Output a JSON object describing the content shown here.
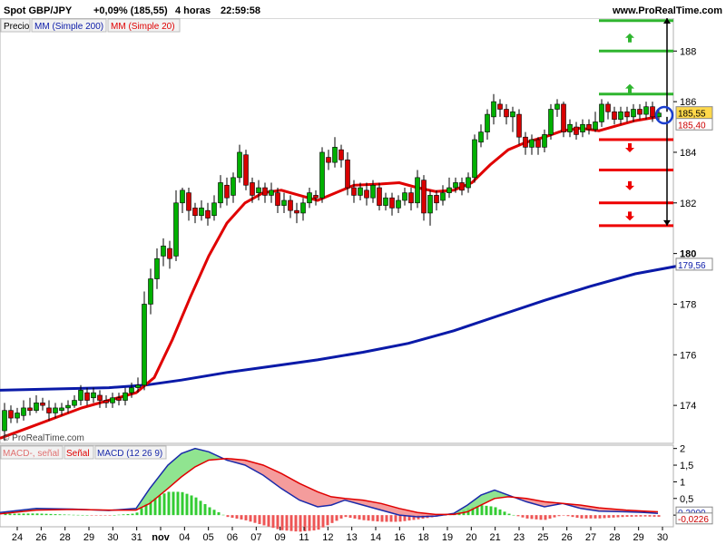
{
  "header": {
    "instrument": "Spot GBP/JPY",
    "change": "+0,09% (185,55)",
    "timeframe": "4 horas",
    "time": "22:59:58",
    "site": "www.ProRealTime.com"
  },
  "legend": {
    "price": "Precio",
    "mm200": "MM (Simple 200)",
    "mm20": "MM (Simple 20)"
  },
  "watermark": "© ProRealTime.com",
  "macd_legend": {
    "item1": "MACD-, señal",
    "item2": "Señal",
    "item3": "MACD (12 26 9)"
  },
  "colors": {
    "up_candle": "#00b000",
    "down_candle": "#d80000",
    "mm200": "#0a1aa8",
    "mm20": "#e00000",
    "resistance": "#2fb52f",
    "support": "#ee0000",
    "macd_hist": "#33cc33"
  },
  "chart_data": {
    "type": "candlestick",
    "x_labels": [
      "24",
      "26",
      "28",
      "29",
      "30",
      "31",
      "nov",
      "04",
      "05",
      "06",
      "07",
      "09",
      "11",
      "12",
      "13",
      "14",
      "16",
      "18",
      "19",
      "20",
      "21",
      "23",
      "25",
      "26",
      "27",
      "28",
      "29",
      "30"
    ],
    "y_ticks": [
      174,
      176,
      178,
      180,
      182,
      184,
      186,
      188
    ],
    "ylim": [
      172.5,
      189.3
    ],
    "last_price_label": "185,55",
    "prev_label": "185,40",
    "mm200_label": "179,56",
    "highlight_tick": "180",
    "resistance_levels": [
      189.2,
      188.0,
      186.3
    ],
    "support_levels": [
      184.5,
      183.3,
      182.0,
      181.1
    ],
    "mm200_points": [
      [
        0,
        174.6
      ],
      [
        60,
        174.65
      ],
      [
        120,
        174.7
      ],
      [
        160,
        174.8
      ],
      [
        200,
        175.0
      ],
      [
        250,
        175.3
      ],
      [
        300,
        175.55
      ],
      [
        350,
        175.8
      ],
      [
        400,
        176.1
      ],
      [
        450,
        176.45
      ],
      [
        500,
        176.95
      ],
      [
        550,
        177.55
      ],
      [
        600,
        178.15
      ],
      [
        650,
        178.7
      ],
      [
        700,
        179.2
      ],
      [
        755,
        179.56
      ]
    ],
    "mm20_points": [
      [
        0,
        172.7
      ],
      [
        30,
        173.1
      ],
      [
        60,
        173.5
      ],
      [
        90,
        173.9
      ],
      [
        120,
        174.2
      ],
      [
        150,
        174.5
      ],
      [
        170,
        175.1
      ],
      [
        190,
        176.6
      ],
      [
        210,
        178.3
      ],
      [
        230,
        179.9
      ],
      [
        250,
        181.2
      ],
      [
        270,
        182.0
      ],
      [
        290,
        182.4
      ],
      [
        310,
        182.5
      ],
      [
        330,
        182.3
      ],
      [
        350,
        182.1
      ],
      [
        370,
        182.4
      ],
      [
        390,
        182.7
      ],
      [
        420,
        182.75
      ],
      [
        440,
        182.8
      ],
      [
        460,
        182.6
      ],
      [
        480,
        182.45
      ],
      [
        500,
        182.5
      ],
      [
        520,
        182.8
      ],
      [
        540,
        183.5
      ],
      [
        560,
        184.1
      ],
      [
        580,
        184.4
      ],
      [
        600,
        184.6
      ],
      [
        620,
        184.85
      ],
      [
        640,
        184.95
      ],
      [
        660,
        184.85
      ],
      [
        680,
        185.05
      ],
      [
        700,
        185.25
      ],
      [
        725,
        185.4
      ]
    ],
    "candles": [
      [
        5,
        173.0,
        173.8,
        172.6,
        174.1
      ],
      [
        12,
        173.8,
        173.5,
        173.3,
        174.0
      ],
      [
        19,
        173.5,
        173.7,
        173.3,
        173.9
      ],
      [
        26,
        173.6,
        173.9,
        173.4,
        174.2
      ],
      [
        33,
        173.9,
        173.8,
        173.6,
        174.3
      ],
      [
        40,
        173.8,
        174.1,
        173.7,
        174.4
      ],
      [
        47,
        174.1,
        174.0,
        173.8,
        174.3
      ],
      [
        54,
        173.9,
        173.7,
        173.4,
        174.2
      ],
      [
        61,
        173.7,
        173.9,
        173.5,
        174.1
      ],
      [
        68,
        173.8,
        173.9,
        173.6,
        174.1
      ],
      [
        75,
        173.9,
        174.0,
        173.7,
        174.2
      ],
      [
        82,
        174.0,
        174.2,
        173.9,
        174.4
      ],
      [
        89,
        174.2,
        174.6,
        174.0,
        174.8
      ],
      [
        96,
        174.5,
        174.2,
        174.0,
        174.7
      ],
      [
        103,
        174.3,
        174.5,
        174.1,
        174.7
      ],
      [
        110,
        174.4,
        174.2,
        173.9,
        174.6
      ],
      [
        117,
        174.2,
        174.1,
        173.9,
        174.4
      ],
      [
        124,
        174.1,
        174.3,
        173.9,
        174.5
      ],
      [
        131,
        174.3,
        174.2,
        174.0,
        174.5
      ],
      [
        138,
        174.2,
        174.5,
        174.0,
        174.7
      ],
      [
        145,
        174.5,
        174.7,
        174.3,
        174.9
      ],
      [
        152,
        174.7,
        174.8,
        174.5,
        175.1
      ],
      [
        159,
        174.8,
        178.0,
        174.6,
        178.5
      ],
      [
        166,
        178.0,
        179.0,
        177.6,
        179.4
      ],
      [
        173,
        179.0,
        179.8,
        178.6,
        180.2
      ],
      [
        180,
        179.9,
        180.3,
        179.5,
        180.6
      ],
      [
        187,
        180.2,
        179.8,
        179.4,
        180.5
      ],
      [
        194,
        179.9,
        182.0,
        179.7,
        182.5
      ],
      [
        201,
        182.0,
        182.5,
        181.6,
        182.6
      ],
      [
        208,
        182.4,
        181.7,
        181.3,
        182.6
      ],
      [
        215,
        181.8,
        181.5,
        181.2,
        182.0
      ],
      [
        222,
        181.5,
        181.8,
        181.3,
        182.1
      ],
      [
        229,
        181.7,
        181.4,
        181.1,
        182.0
      ],
      [
        236,
        181.5,
        182.0,
        181.3,
        182.3
      ],
      [
        243,
        182.0,
        182.8,
        181.8,
        183.1
      ],
      [
        250,
        182.7,
        182.2,
        181.9,
        183.0
      ],
      [
        257,
        182.3,
        183.0,
        182.0,
        183.2
      ],
      [
        264,
        183.0,
        184.0,
        182.8,
        184.3
      ],
      [
        271,
        183.9,
        182.7,
        182.5,
        184.1
      ],
      [
        278,
        182.8,
        182.3,
        182.0,
        183.0
      ],
      [
        285,
        182.4,
        182.6,
        182.1,
        182.9
      ],
      [
        292,
        182.6,
        182.3,
        182.0,
        182.8
      ],
      [
        299,
        182.3,
        182.5,
        182.0,
        182.8
      ],
      [
        306,
        182.4,
        181.9,
        181.6,
        182.6
      ],
      [
        313,
        181.9,
        182.1,
        181.6,
        182.4
      ],
      [
        320,
        182.1,
        181.7,
        181.4,
        182.3
      ],
      [
        327,
        181.7,
        181.6,
        181.2,
        182.0
      ],
      [
        334,
        181.6,
        182.0,
        181.3,
        182.2
      ],
      [
        341,
        182.0,
        182.4,
        181.8,
        182.6
      ],
      [
        348,
        182.3,
        182.2,
        181.9,
        182.5
      ],
      [
        355,
        182.2,
        184.0,
        182.0,
        184.2
      ],
      [
        362,
        183.8,
        183.6,
        183.3,
        184.1
      ],
      [
        369,
        183.6,
        184.2,
        183.4,
        184.6
      ],
      [
        376,
        184.1,
        183.7,
        183.4,
        184.3
      ],
      [
        383,
        183.7,
        182.6,
        182.3,
        184.0
      ],
      [
        390,
        182.6,
        182.3,
        182.0,
        182.9
      ],
      [
        397,
        182.3,
        182.6,
        182.1,
        182.8
      ],
      [
        404,
        182.5,
        182.2,
        181.9,
        182.8
      ],
      [
        411,
        182.2,
        182.7,
        182.0,
        182.9
      ],
      [
        418,
        182.6,
        181.9,
        181.7,
        182.8
      ],
      [
        425,
        181.9,
        182.2,
        181.7,
        182.4
      ],
      [
        432,
        182.2,
        181.8,
        181.5,
        182.4
      ],
      [
        439,
        181.8,
        182.1,
        181.6,
        182.3
      ],
      [
        446,
        182.1,
        182.4,
        181.9,
        182.6
      ],
      [
        453,
        182.4,
        182.0,
        181.7,
        182.6
      ],
      [
        460,
        182.0,
        183.0,
        181.8,
        183.3
      ],
      [
        467,
        182.9,
        181.6,
        181.3,
        183.1
      ],
      [
        474,
        181.6,
        182.3,
        181.1,
        182.5
      ],
      [
        481,
        182.3,
        182.0,
        181.7,
        182.5
      ],
      [
        488,
        182.1,
        182.4,
        181.9,
        182.7
      ],
      [
        495,
        182.4,
        182.6,
        182.2,
        183.0
      ],
      [
        502,
        182.6,
        182.8,
        182.4,
        183.0
      ],
      [
        509,
        182.8,
        182.5,
        182.3,
        183.0
      ],
      [
        516,
        182.6,
        183.0,
        182.4,
        183.2
      ],
      [
        523,
        183.0,
        184.5,
        182.8,
        184.7
      ],
      [
        530,
        184.4,
        184.8,
        184.2,
        185.1
      ],
      [
        537,
        184.8,
        185.5,
        184.5,
        185.7
      ],
      [
        544,
        185.4,
        186.0,
        185.1,
        186.3
      ],
      [
        551,
        185.9,
        185.7,
        185.4,
        186.1
      ],
      [
        558,
        185.7,
        185.4,
        185.1,
        185.9
      ],
      [
        565,
        185.4,
        185.6,
        184.8,
        185.8
      ],
      [
        572,
        185.5,
        184.6,
        184.3,
        185.7
      ],
      [
        579,
        184.6,
        184.2,
        183.9,
        184.8
      ],
      [
        586,
        184.2,
        184.5,
        183.9,
        184.7
      ],
      [
        593,
        184.5,
        184.2,
        183.9,
        184.6
      ],
      [
        600,
        184.2,
        184.7,
        184.0,
        184.9
      ],
      [
        607,
        184.7,
        185.7,
        184.5,
        185.9
      ],
      [
        614,
        185.7,
        185.9,
        185.4,
        186.1
      ],
      [
        621,
        185.9,
        184.8,
        184.6,
        186.0
      ],
      [
        628,
        184.8,
        185.1,
        184.6,
        185.3
      ],
      [
        635,
        185.0,
        184.7,
        184.5,
        185.2
      ],
      [
        642,
        184.8,
        185.1,
        184.6,
        185.3
      ],
      [
        649,
        185.1,
        184.9,
        184.7,
        185.3
      ],
      [
        656,
        184.9,
        185.2,
        184.8,
        185.6
      ],
      [
        663,
        185.2,
        185.9,
        185.0,
        186.1
      ],
      [
        670,
        185.9,
        185.6,
        185.3,
        186.0
      ],
      [
        677,
        185.6,
        185.3,
        185.1,
        185.8
      ],
      [
        684,
        185.3,
        185.6,
        185.1,
        185.8
      ],
      [
        691,
        185.6,
        185.4,
        185.2,
        185.8
      ],
      [
        698,
        185.4,
        185.7,
        185.2,
        185.9
      ],
      [
        705,
        185.7,
        185.5,
        185.3,
        185.9
      ],
      [
        712,
        185.5,
        185.8,
        185.3,
        186.0
      ],
      [
        719,
        185.8,
        185.4,
        185.2,
        186.0
      ],
      [
        726,
        185.4,
        185.55,
        185.2,
        185.7
      ]
    ],
    "macd_y_ticks": [
      "2",
      "1,5",
      "1",
      "0,5",
      "0"
    ],
    "macd_ylim": [
      -0.35,
      2.1
    ],
    "macd_value_labels": [
      "0,2000",
      "-0,0226"
    ],
    "macd_line": [
      [
        0,
        0.08
      ],
      [
        40,
        0.2
      ],
      [
        80,
        0.18
      ],
      [
        120,
        0.14
      ],
      [
        150,
        0.2
      ],
      [
        165,
        0.8
      ],
      [
        185,
        1.5
      ],
      [
        200,
        1.85
      ],
      [
        215,
        2.0
      ],
      [
        230,
        1.9
      ],
      [
        250,
        1.65
      ],
      [
        270,
        1.5
      ],
      [
        290,
        1.2
      ],
      [
        310,
        0.8
      ],
      [
        330,
        0.45
      ],
      [
        350,
        0.25
      ],
      [
        365,
        0.3
      ],
      [
        380,
        0.45
      ],
      [
        400,
        0.3
      ],
      [
        420,
        0.15
      ],
      [
        440,
        0.0
      ],
      [
        460,
        -0.05
      ],
      [
        480,
        -0.03
      ],
      [
        500,
        0.05
      ],
      [
        515,
        0.3
      ],
      [
        530,
        0.6
      ],
      [
        545,
        0.75
      ],
      [
        560,
        0.6
      ],
      [
        580,
        0.4
      ],
      [
        600,
        0.25
      ],
      [
        620,
        0.35
      ],
      [
        640,
        0.2
      ],
      [
        660,
        0.12
      ],
      [
        690,
        0.1
      ],
      [
        710,
        0.08
      ],
      [
        725,
        0.05
      ]
    ],
    "macd_signal": [
      [
        0,
        0.04
      ],
      [
        40,
        0.15
      ],
      [
        80,
        0.17
      ],
      [
        120,
        0.15
      ],
      [
        150,
        0.15
      ],
      [
        165,
        0.35
      ],
      [
        185,
        0.8
      ],
      [
        200,
        1.15
      ],
      [
        215,
        1.45
      ],
      [
        230,
        1.65
      ],
      [
        250,
        1.7
      ],
      [
        270,
        1.65
      ],
      [
        290,
        1.5
      ],
      [
        310,
        1.25
      ],
      [
        330,
        0.95
      ],
      [
        350,
        0.7
      ],
      [
        365,
        0.55
      ],
      [
        380,
        0.5
      ],
      [
        400,
        0.45
      ],
      [
        420,
        0.35
      ],
      [
        440,
        0.2
      ],
      [
        460,
        0.08
      ],
      [
        480,
        0.02
      ],
      [
        500,
        0.02
      ],
      [
        515,
        0.1
      ],
      [
        530,
        0.3
      ],
      [
        545,
        0.5
      ],
      [
        560,
        0.55
      ],
      [
        580,
        0.5
      ],
      [
        600,
        0.4
      ],
      [
        620,
        0.35
      ],
      [
        640,
        0.3
      ],
      [
        660,
        0.22
      ],
      [
        690,
        0.15
      ],
      [
        710,
        0.12
      ],
      [
        725,
        0.1
      ]
    ]
  }
}
